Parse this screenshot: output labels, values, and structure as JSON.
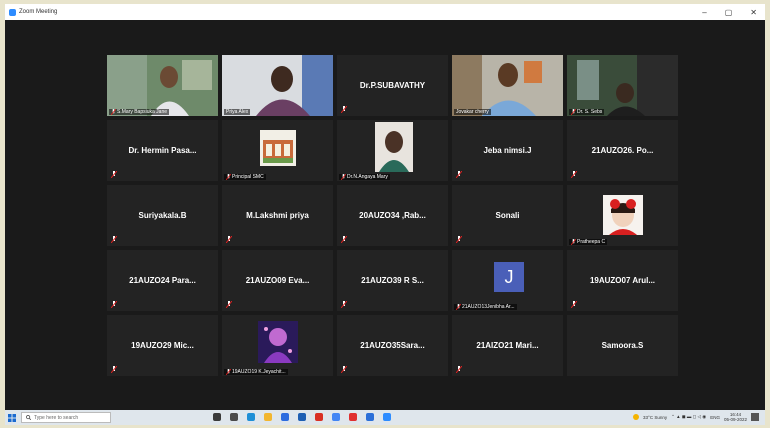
{
  "window": {
    "title": "Zoom Meeting",
    "minimize": "–",
    "maximize": "▢",
    "close": "✕"
  },
  "tiles": [
    {
      "id": "t1",
      "caption": "S.Mary Bapsiuka Jane",
      "kind": "video"
    },
    {
      "id": "t2",
      "caption": "Priya Alex",
      "kind": "video"
    },
    {
      "id": "t3",
      "name": "Dr.P.SUBAVATHY",
      "kind": "name"
    },
    {
      "id": "t4",
      "caption": "Jovakar cherry",
      "kind": "video"
    },
    {
      "id": "t5",
      "caption": "Dr. S. Sebs",
      "kind": "video"
    },
    {
      "id": "t6",
      "name": "Dr. Hermin Pasa...",
      "kind": "name"
    },
    {
      "id": "t7",
      "caption": "Principal SMC",
      "kind": "photo"
    },
    {
      "id": "t8",
      "caption": "Dr.N.Angaya Mary",
      "kind": "photo"
    },
    {
      "id": "t9",
      "name": "Jeba nimsi.J",
      "kind": "name"
    },
    {
      "id": "t10",
      "name": "21AUZO26.  Po...",
      "kind": "name"
    },
    {
      "id": "t11",
      "name": "Suriyakala.B",
      "kind": "name"
    },
    {
      "id": "t12",
      "name": "M.Lakshmi priya",
      "kind": "name"
    },
    {
      "id": "t13",
      "name": "20AUZO34  ,Rab...",
      "kind": "name"
    },
    {
      "id": "t14",
      "name": "Sonali",
      "kind": "name"
    },
    {
      "id": "t15",
      "caption": "Pratheepa C",
      "kind": "photo"
    },
    {
      "id": "t16",
      "name": "21AUZO24  Para...",
      "kind": "name"
    },
    {
      "id": "t17",
      "name": "21AUZO09  Eva...",
      "kind": "name"
    },
    {
      "id": "t18",
      "name": "21AUZO39   R S...",
      "kind": "name"
    },
    {
      "id": "t19",
      "caption": "21AUZO13Jenibha Ar...",
      "avatar": "J",
      "kind": "avatar"
    },
    {
      "id": "t20",
      "name": "19AUZO07   Arul...",
      "kind": "name"
    },
    {
      "id": "t21",
      "name": "19AUZO29   Mic...",
      "kind": "name"
    },
    {
      "id": "t22",
      "caption": "19AUZO19 K.Jeyachit...",
      "kind": "photo"
    },
    {
      "id": "t23",
      "name": "21AUZO35Sara...",
      "kind": "name"
    },
    {
      "id": "t24",
      "name": "21AIZO21   Mari...",
      "kind": "name"
    },
    {
      "id": "t25",
      "name": "Samoora.S",
      "kind": "name"
    }
  ],
  "taskbar": {
    "search_placeholder": "Type here to search",
    "weather": "33°C  Sunny",
    "language": "ENG",
    "time": "16:44",
    "date": "05-09-2022"
  },
  "colors": {
    "active_border": "#c8d94a",
    "mic_muted": "#e02020",
    "avatar_bg": "#4a5fb8"
  }
}
